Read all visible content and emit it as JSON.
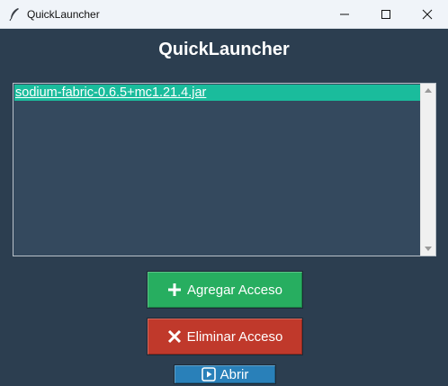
{
  "window": {
    "title": "QuickLauncher"
  },
  "header": {
    "title": "QuickLauncher"
  },
  "list": {
    "items": [
      {
        "label": "sodium-fabric-0.6.5+mc1.21.4.jar",
        "selected": true
      }
    ]
  },
  "buttons": {
    "add_label": "Agregar Acceso",
    "remove_label": "Eliminar Acceso",
    "open_label": "Abrir"
  },
  "colors": {
    "background": "#2c3e50",
    "list_background": "#34495e",
    "selection": "#1abc9c",
    "add": "#27ae60",
    "remove": "#c0392b",
    "open": "#2980b9"
  },
  "icons": {
    "add": "plus-icon",
    "remove": "x-icon",
    "open": "play-icon"
  }
}
